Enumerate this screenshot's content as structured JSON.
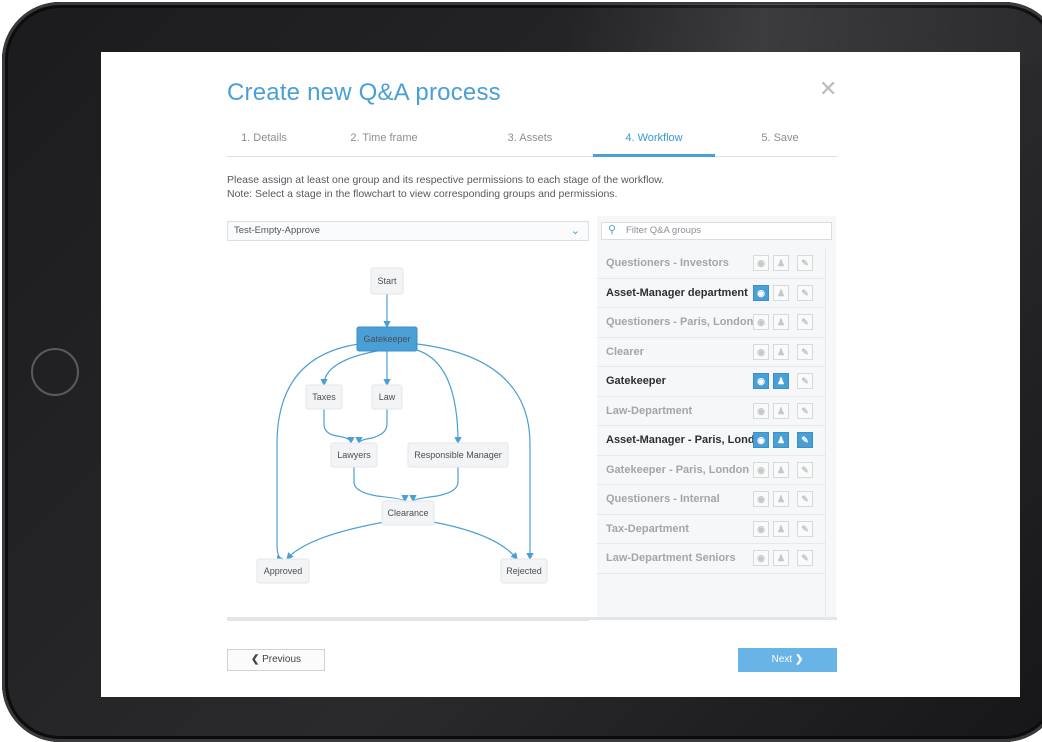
{
  "dialog": {
    "title": "Create new Q&A process",
    "close_icon": "close-icon",
    "steps": [
      {
        "label": "1. Details",
        "active": false
      },
      {
        "label": "2. Time frame",
        "active": false
      },
      {
        "label": "3. Assets",
        "active": false
      },
      {
        "label": "4. Workflow",
        "active": true
      },
      {
        "label": "5. Save",
        "active": false
      }
    ],
    "instructions": {
      "line1": "Please assign at least one group and its respective permissions to each stage of the workflow.",
      "line2": "Note: Select a stage in the flowchart to view corresponding groups and permissions."
    }
  },
  "workflow": {
    "selected": "Test-Empty-Approve",
    "dropdown_icon": "chevron-down-icon",
    "nodes": [
      {
        "id": "start",
        "label": "Start",
        "selected": false
      },
      {
        "id": "gatekeeper",
        "label": "Gatekeeper",
        "selected": true
      },
      {
        "id": "taxes",
        "label": "Taxes",
        "selected": false
      },
      {
        "id": "law",
        "label": "Law",
        "selected": false
      },
      {
        "id": "lawyers",
        "label": "Lawyers",
        "selected": false
      },
      {
        "id": "responsible",
        "label": "Responsible Manager",
        "selected": false
      },
      {
        "id": "clearance",
        "label": "Clearance",
        "selected": false
      },
      {
        "id": "approved",
        "label": "Approved",
        "selected": false
      },
      {
        "id": "rejected",
        "label": "Rejected",
        "selected": false
      }
    ],
    "edges": [
      [
        "start",
        "gatekeeper"
      ],
      [
        "gatekeeper",
        "taxes"
      ],
      [
        "gatekeeper",
        "law"
      ],
      [
        "gatekeeper",
        "responsible"
      ],
      [
        "gatekeeper",
        "approved"
      ],
      [
        "gatekeeper",
        "rejected"
      ],
      [
        "taxes",
        "lawyers"
      ],
      [
        "law",
        "lawyers"
      ],
      [
        "lawyers",
        "clearance"
      ],
      [
        "responsible",
        "clearance"
      ],
      [
        "clearance",
        "approved"
      ],
      [
        "clearance",
        "rejected"
      ]
    ],
    "accent": "#4a9fd6"
  },
  "groups": {
    "filter_placeholder": "Filter Q&A groups",
    "search_icon": "search-icon",
    "permission_icons": [
      "eye-icon",
      "user-icon",
      "pencil-icon"
    ],
    "items": [
      {
        "name": "Questioners - Investors",
        "active": false,
        "view": false,
        "assign": false,
        "edit": false
      },
      {
        "name": "Asset-Manager department",
        "active": true,
        "view": true,
        "assign": false,
        "edit": false
      },
      {
        "name": "Questioners - Paris, London",
        "active": false,
        "view": false,
        "assign": false,
        "edit": false
      },
      {
        "name": "Clearer",
        "active": false,
        "view": false,
        "assign": false,
        "edit": false
      },
      {
        "name": "Gatekeeper",
        "active": true,
        "view": true,
        "assign": true,
        "edit": false
      },
      {
        "name": "Law-Department",
        "active": false,
        "view": false,
        "assign": false,
        "edit": false
      },
      {
        "name": "Asset-Manager - Paris, Lond...",
        "active": true,
        "view": true,
        "assign": true,
        "edit": true
      },
      {
        "name": "Gatekeeper - Paris, London",
        "active": false,
        "view": false,
        "assign": false,
        "edit": false
      },
      {
        "name": "Questioners - Internal",
        "active": false,
        "view": false,
        "assign": false,
        "edit": false
      },
      {
        "name": "Tax-Department",
        "active": false,
        "view": false,
        "assign": false,
        "edit": false
      },
      {
        "name": "Law-Department Seniors",
        "active": false,
        "view": false,
        "assign": false,
        "edit": false
      }
    ]
  },
  "footer": {
    "previous_label": "Previous",
    "next_label": "Next",
    "previous_icon": "chevron-left-icon",
    "next_icon": "chevron-right-icon"
  }
}
